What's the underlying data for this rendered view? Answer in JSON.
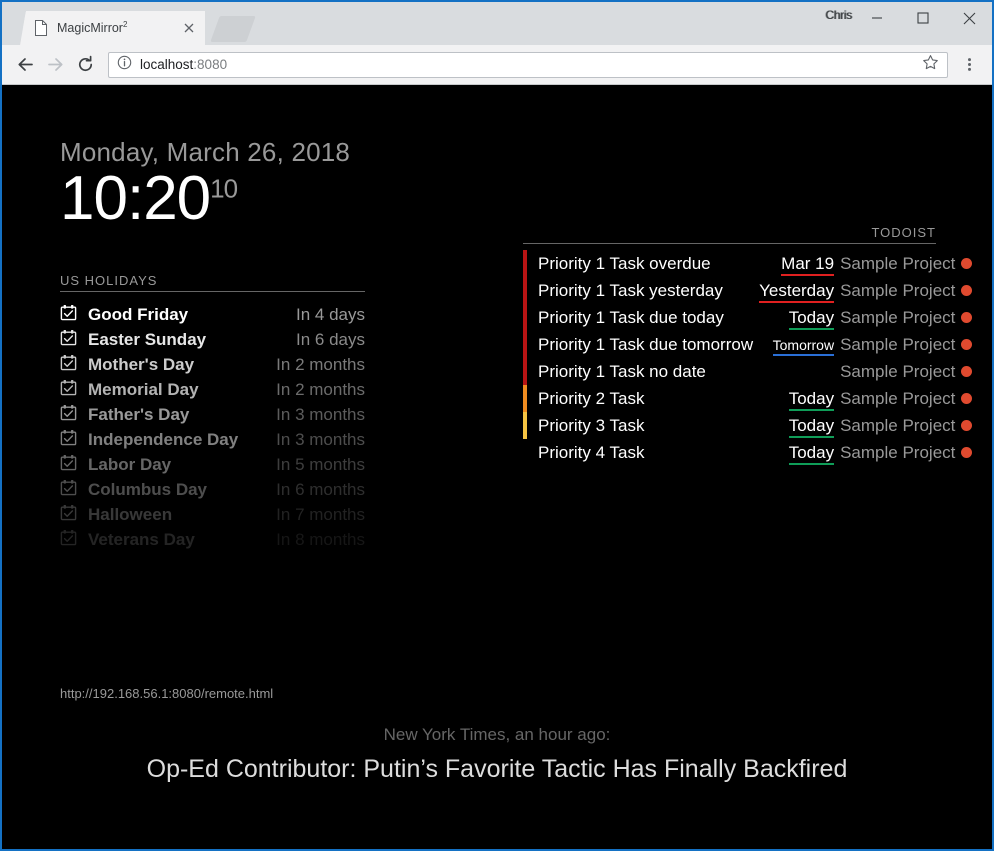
{
  "browser": {
    "profile_name": "Chris",
    "tab": {
      "title": "MagicMirror",
      "superscript": "2",
      "favicon": "page-icon",
      "close": "close-icon"
    },
    "new_tab_label": "",
    "window_controls": {
      "minimize": "minimize-icon",
      "maximize": "maximize-icon",
      "close": "close-icon"
    },
    "nav": {
      "back": "back-arrow-icon",
      "forward": "forward-arrow-icon",
      "reload": "reload-icon"
    },
    "omnibox": {
      "info": "info-icon",
      "host": "localhost",
      "port": ":8080",
      "star": "star-icon"
    },
    "menu": "three-dot-menu-icon"
  },
  "clock": {
    "date": "Monday, March 26, 2018",
    "time": "10:20",
    "seconds": "10"
  },
  "holidays": {
    "header": "US HOLIDAYS",
    "items": [
      {
        "icon": "calendar-check-icon",
        "title": "Good Friday",
        "when": "In 4 days",
        "opacity": 1.0
      },
      {
        "icon": "calendar-check-icon",
        "title": "Easter Sunday",
        "when": "In 6 days",
        "opacity": 0.9
      },
      {
        "icon": "calendar-check-icon",
        "title": "Mother's Day",
        "when": "In 2 months",
        "opacity": 0.8
      },
      {
        "icon": "calendar-check-icon",
        "title": "Memorial Day",
        "when": "In 2 months",
        "opacity": 0.7
      },
      {
        "icon": "calendar-check-icon",
        "title": "Father's Day",
        "when": "In 3 months",
        "opacity": 0.6
      },
      {
        "icon": "calendar-check-icon",
        "title": "Independence Day",
        "when": "In 3 months",
        "opacity": 0.5
      },
      {
        "icon": "calendar-check-icon",
        "title": "Labor Day",
        "when": "In 5 months",
        "opacity": 0.4
      },
      {
        "icon": "calendar-check-icon",
        "title": "Columbus Day",
        "when": "In 6 months",
        "opacity": 0.3
      },
      {
        "icon": "calendar-check-icon",
        "title": "Halloween",
        "when": "In 7 months",
        "opacity": 0.22
      },
      {
        "icon": "calendar-check-icon",
        "title": "Veterans Day",
        "when": "In 8 months",
        "opacity": 0.14
      }
    ]
  },
  "todoist": {
    "header": "TODOIST",
    "colors": {
      "priority_1": "#b81414",
      "priority_2": "#ef8c20",
      "priority_3": "#f5c342",
      "priority_4": "transparent",
      "project_dot": "#e04a2f",
      "due_overdue": "#e02020",
      "due_today": "#0f9d58",
      "due_tomorrow": "#2a6fd6"
    },
    "tasks": [
      {
        "title": "Priority 1 Task overdue",
        "due": "Mar 19",
        "due_state": "overdue",
        "project": "Sample Project",
        "priority": 1
      },
      {
        "title": "Priority 1 Task yesterday",
        "due": "Yesterday",
        "due_state": "overdue",
        "project": "Sample Project",
        "priority": 1
      },
      {
        "title": "Priority 1 Task due today",
        "due": "Today",
        "due_state": "today",
        "project": "Sample Project",
        "priority": 1
      },
      {
        "title": "Priority 1 Task due tomorrow",
        "due": "Tomorrow",
        "due_state": "tomorrow",
        "project": "Sample Project",
        "priority": 1
      },
      {
        "title": "Priority 1 Task no date",
        "due": "",
        "due_state": "none",
        "project": "Sample Project",
        "priority": 1
      },
      {
        "title": "Priority 2 Task",
        "due": "Today",
        "due_state": "today",
        "project": "Sample Project",
        "priority": 2
      },
      {
        "title": "Priority 3 Task",
        "due": "Today",
        "due_state": "today",
        "project": "Sample Project",
        "priority": 3
      },
      {
        "title": "Priority 4 Task",
        "due": "Today",
        "due_state": "today",
        "project": "Sample Project",
        "priority": 4
      }
    ]
  },
  "remote": {
    "url": "http://192.168.56.1:8080/remote.html"
  },
  "newsfeed": {
    "source": "New York Times, an hour ago:",
    "title": "Op-Ed Contributor: Putin’s Favorite Tactic Has Finally Backfired"
  }
}
